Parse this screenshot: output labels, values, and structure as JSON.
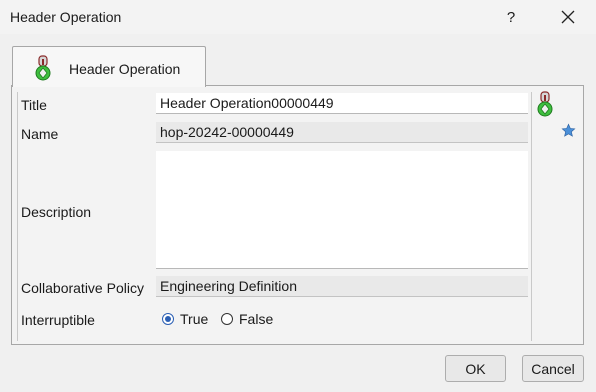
{
  "window": {
    "title": "Header Operation",
    "help_label": "?"
  },
  "tab": {
    "label": "Header Operation"
  },
  "form": {
    "title_label": "Title",
    "title_value": "Header Operation00000449",
    "name_label": "Name",
    "name_value": "hop-20242-00000449",
    "description_label": "Description",
    "description_value": "",
    "policy_label": "Collaborative Policy",
    "policy_value": "Engineering Definition",
    "interruptible_label": "Interruptible",
    "options": [
      {
        "label": "True",
        "selected": true
      },
      {
        "label": "False",
        "selected": false
      }
    ]
  },
  "buttons": {
    "ok": "OK",
    "cancel": "Cancel"
  },
  "colors": {
    "accent": "#2b5fb4",
    "icon_green": "#3fbf3f",
    "star_blue": "#4a8fd8"
  }
}
